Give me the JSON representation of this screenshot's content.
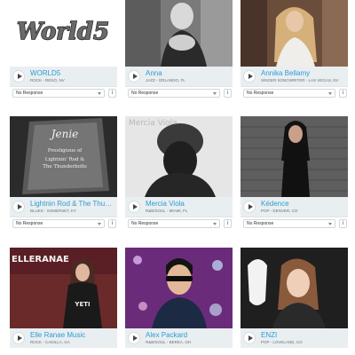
{
  "artists": [
    {
      "name": "WORLD5",
      "sub": "ROCK - RENO, NV",
      "status": "No Response",
      "icon": "play-icon",
      "thumb": "logo-world5"
    },
    {
      "name": "Anna",
      "sub": "JAZZ - ORLANDO, FL",
      "status": "No Response",
      "icon": "play-icon",
      "thumb": "photo-bw-woman"
    },
    {
      "name": "Annika Bellamy",
      "sub": "SINGER SONGWRITER - LAS VEGAS, NV",
      "status": "No Response",
      "icon": "play-icon",
      "thumb": "photo-woman-blonde"
    },
    {
      "name": "Lightnin Rod & The Thu…",
      "sub": "BLUES - SOMERSET, KY",
      "status": "No Response",
      "icon": "play-icon",
      "thumb": "photo-award"
    },
    {
      "name": "Mercia Viola",
      "sub": "R&B/SOUL - MIAMI, FL",
      "status": "No Response",
      "icon": "play-icon",
      "thumb": "photo-beanie"
    },
    {
      "name": "Kédence",
      "sub": "POP - DENVER, CO",
      "status": "No Response",
      "icon": "play-icon",
      "thumb": "photo-brick-wall"
    },
    {
      "name": "Elle Ranae Music",
      "sub": "ROCK - CADILLA, GA",
      "status": "No Response",
      "icon": "play-icon",
      "thumb": "photo-elleranae"
    },
    {
      "name": "Alex Packard",
      "sub": "R&B/SOUL - BEREA, OH",
      "status": "No Response",
      "icon": "play-icon",
      "thumb": "photo-sunglasses"
    },
    {
      "name": "ENZI",
      "sub": "POP - LOVELAND, CO",
      "status": "No Response",
      "icon": "play-icon",
      "thumb": "photo-guitar"
    }
  ],
  "thumb_text": {
    "world5_logo": "World5",
    "award_script": "Jenie",
    "award_line1": "Prestigious of",
    "award_line2": "Lightnin' Rod &",
    "award_line3": "The Thunderbolts",
    "mercia_caption": "Mercia Viola",
    "elleranae_caption": "ELLERANAE",
    "elleranae_shirt": "YETI"
  },
  "info_label": "i"
}
